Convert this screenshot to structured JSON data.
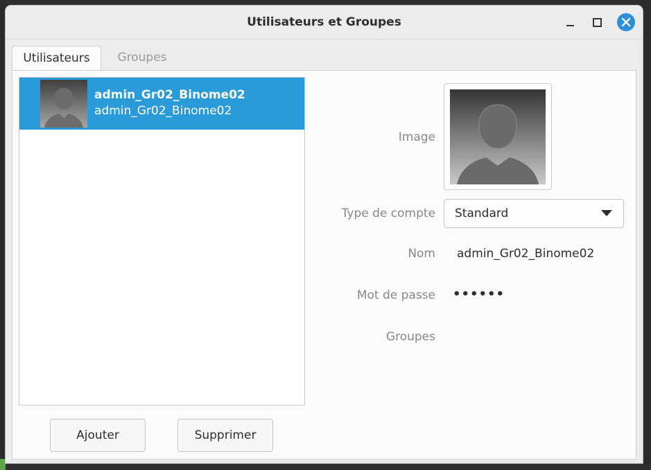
{
  "window": {
    "title": "Utilisateurs et Groupes"
  },
  "tabs": [
    {
      "label": "Utilisateurs",
      "active": true
    },
    {
      "label": "Groupes",
      "active": false
    }
  ],
  "users": [
    {
      "name": "admin_Gr02_Binome02",
      "login": "admin_Gr02_Binome02",
      "selected": true
    }
  ],
  "buttons": {
    "add": "Ajouter",
    "delete": "Supprimer"
  },
  "details": {
    "image_label": "Image",
    "account_type_label": "Type de compte",
    "account_type_value": "Standard",
    "name_label": "Nom",
    "name_value": "admin_Gr02_Binome02",
    "password_label": "Mot de passe",
    "password_value": "••••••",
    "groups_label": "Groupes"
  },
  "colors": {
    "selection": "#2b9ad8",
    "close_button": "#2b90d9"
  },
  "icons": {
    "avatar": "default-user-avatar-icon",
    "dropdown": "chevron-down-icon",
    "close": "close-icon",
    "minimize": "minimize-icon",
    "maximize": "maximize-icon"
  }
}
